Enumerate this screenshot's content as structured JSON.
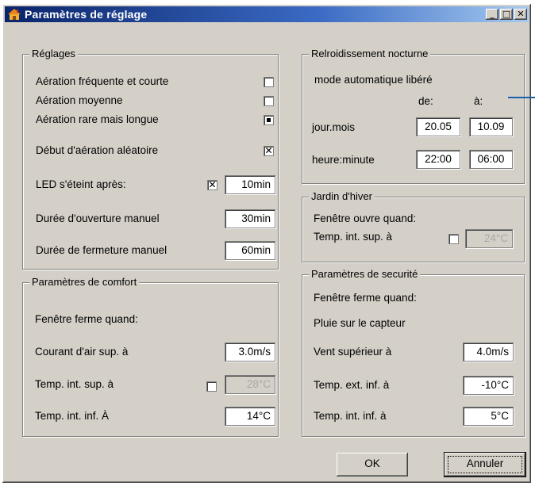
{
  "window": {
    "title": "Paramètres de réglage",
    "controls": {
      "minimize": "_",
      "maximize": "□",
      "close": "✕"
    }
  },
  "reglages": {
    "legend": "Réglages",
    "rows": [
      {
        "label": "Aération fréquente et courte",
        "checkbox": ""
      },
      {
        "label": "Aération moyenne",
        "checkbox": ""
      },
      {
        "label": "Aération rare mais longue",
        "checkbox": "dot"
      },
      {
        "label": "Début d'aération aléatoire",
        "checkbox": "✕"
      }
    ],
    "led": {
      "label": "LED s'éteint après:",
      "checked": "✕",
      "value": "10min"
    },
    "ouverture": {
      "label": "Durée d'ouverture manuel",
      "value": "30min"
    },
    "fermeture": {
      "label": "Durée de fermeture manuel",
      "value": "60min"
    }
  },
  "refroid": {
    "legend": "Relroidissement nocturne",
    "mode": "mode automatique libéré",
    "col_de": "de:",
    "col_a": "à:",
    "jour": {
      "label": "jour.mois",
      "de": "20.05",
      "a": "10.09"
    },
    "heure": {
      "label": "heure:minute",
      "de": "22:00",
      "a": "06:00"
    }
  },
  "jardin": {
    "legend": "Jardin d'hiver",
    "fenetre": "Fenêtre ouvre quand:",
    "temp": {
      "label": "Temp. int. sup. à",
      "checkbox": "",
      "value": "24°C"
    }
  },
  "confort": {
    "legend": "Paramètres de comfort",
    "fenetre": "Fenêtre ferme quand:",
    "courant": {
      "label": "Courant d'air sup. à",
      "value": "3.0m/s"
    },
    "temp_sup": {
      "label": "Temp. int. sup. à",
      "checkbox": "",
      "value": "28°C"
    },
    "temp_inf": {
      "label": "Temp. int. inf. À",
      "value": "14°C"
    }
  },
  "securite": {
    "legend": "Paramètres de securité",
    "fenetre": "Fenêtre ferme quand:",
    "pluie": "Pluie sur le capteur",
    "vent": {
      "label": "Vent supérieur à",
      "value": "4.0m/s"
    },
    "temp_ext": {
      "label": "Temp. ext. inf. à",
      "value": "-10°C"
    },
    "temp_int": {
      "label": "Temp. int. inf. à",
      "value": "5°C"
    }
  },
  "buttons": {
    "ok": "OK",
    "cancel": "Annuler"
  },
  "colors": {
    "title_start": "#0a246a",
    "title_end": "#a6caf0",
    "face": "#d4d0c8",
    "pointer": "#1a5fa8"
  }
}
